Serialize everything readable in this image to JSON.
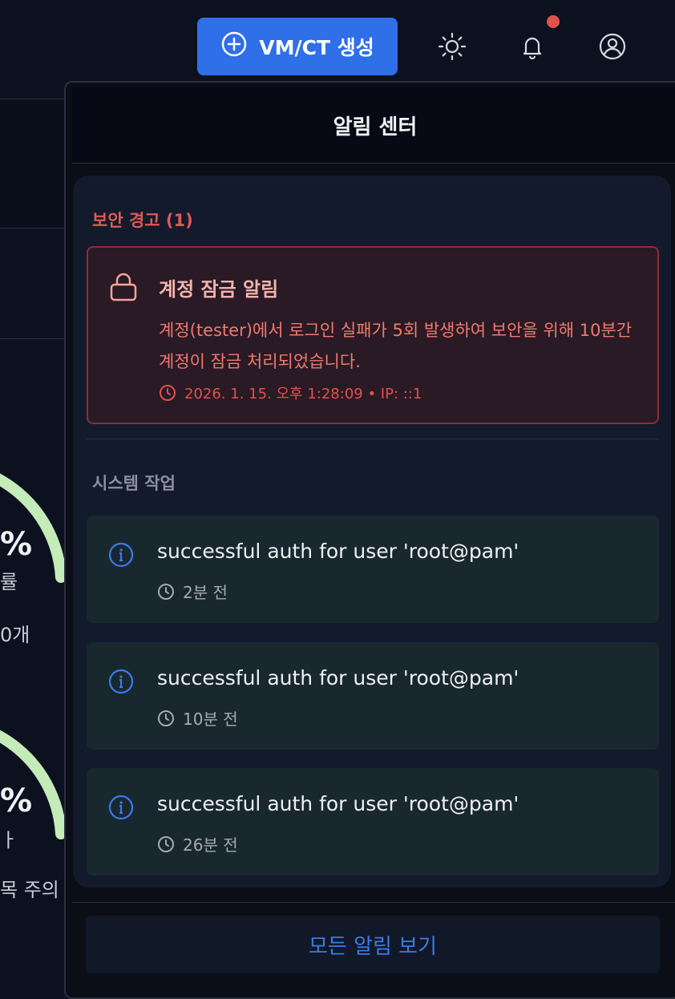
{
  "topbar": {
    "create_label": "VM/CT 생성",
    "icons": [
      "plus-circle-icon",
      "sun-icon",
      "bell-icon",
      "user-circle-icon"
    ],
    "accent": "#2f6fe8",
    "notif_dot_color": "#e0514d"
  },
  "background": {
    "gauge1_label": "률",
    "gauge1_sub": "0개",
    "gauge2_label": "ㅏ",
    "gauge2_sub": "목 주의",
    "pct_symbol": "%",
    "gauge_color": "#c5ebb8"
  },
  "panel": {
    "title": "알림 센터",
    "security": {
      "section_title": "보안 경고 (1)",
      "alert": {
        "title": "계정 잠금 알림",
        "message": "계정(tester)에서 로그인 실패가 5회 발생하여 보안을 위해 10분간 계정이 잠금 처리되었습니다.",
        "meta": "2026. 1. 15. 오후 1:28:09 • IP: ::1",
        "icon": "lock-icon"
      }
    },
    "system": {
      "section_title": "시스템 작업",
      "items": [
        {
          "message": "successful auth for user 'root@pam'",
          "time": "2분 전"
        },
        {
          "message": "successful auth for user 'root@pam'",
          "time": "10분 전"
        },
        {
          "message": "successful auth for user 'root@pam'",
          "time": "26분 전"
        }
      ]
    },
    "view_all_label": "모든 알림 보기"
  }
}
